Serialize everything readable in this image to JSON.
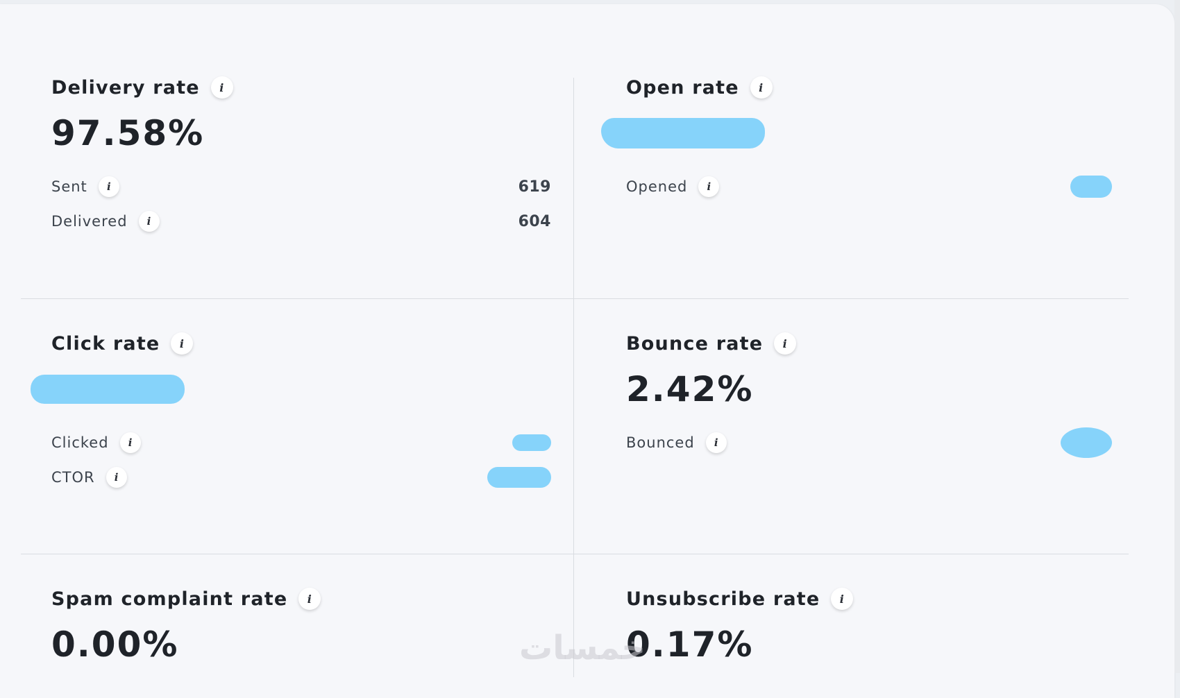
{
  "delivery": {
    "title": "Delivery rate",
    "value": "97.58%",
    "rows": [
      {
        "label": "Sent",
        "value": "619"
      },
      {
        "label": "Delivered",
        "value": "604"
      }
    ]
  },
  "open": {
    "title": "Open rate",
    "rows": [
      {
        "label": "Opened"
      }
    ]
  },
  "click": {
    "title": "Click rate",
    "rows": [
      {
        "label": "Clicked"
      },
      {
        "label": "CTOR"
      }
    ]
  },
  "bounce": {
    "title": "Bounce rate",
    "value": "2.42%",
    "rows": [
      {
        "label": "Bounced"
      }
    ]
  },
  "spam": {
    "title": "Spam complaint rate",
    "value": "0.00%"
  },
  "unsubscribe": {
    "title": "Unsubscribe rate",
    "value": "0.17%"
  },
  "info_glyph": "i",
  "watermark": "خمسات",
  "colors": {
    "redaction": "#86d3fa",
    "panel": "#f6f7fa",
    "divider": "#d9dce1",
    "text": "#1f2329"
  }
}
